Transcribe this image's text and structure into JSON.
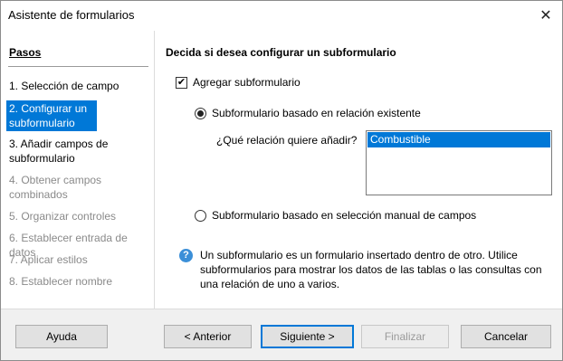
{
  "window": {
    "title": "Asistente de formularios"
  },
  "steps": {
    "title": "Pasos",
    "items": [
      {
        "label": "1. Selección de campo",
        "state": "normal"
      },
      {
        "label": "2. Configurar un subformulario",
        "state": "selected"
      },
      {
        "label": "3. Añadir campos de subformulario",
        "state": "normal"
      },
      {
        "label": "4. Obtener campos combinados",
        "state": "disabled"
      },
      {
        "label": "5. Organizar controles",
        "state": "disabled"
      },
      {
        "label": "6. Establecer entrada de datos",
        "state": "disabled"
      },
      {
        "label": "7. Aplicar estilos",
        "state": "disabled"
      },
      {
        "label": "8. Establecer nombre",
        "state": "disabled"
      }
    ]
  },
  "main": {
    "heading": "Decida si desea configurar un subformulario",
    "add_subform": {
      "label": "Agregar subformulario",
      "checked": true
    },
    "radio_existing": {
      "label": "Subformulario basado en relación existente",
      "selected": true
    },
    "relation_label": "¿Qué relación quiere añadir?",
    "relation_options": [
      "Combustible"
    ],
    "radio_manual": {
      "label": "Subformulario basado en selección manual de campos",
      "selected": false
    },
    "info_text": "Un subformulario es un formulario insertado dentro de otro. Utilice subformularios para mostrar los datos de las tablas o las consultas con una relación de uno a varios."
  },
  "footer": {
    "help": "Ayuda",
    "back": "< Anterior",
    "next": "Siguiente >",
    "finish": "Finalizar",
    "cancel": "Cancelar"
  },
  "colors": {
    "selection": "#0078d7",
    "info_icon": "#3b8fd8"
  }
}
